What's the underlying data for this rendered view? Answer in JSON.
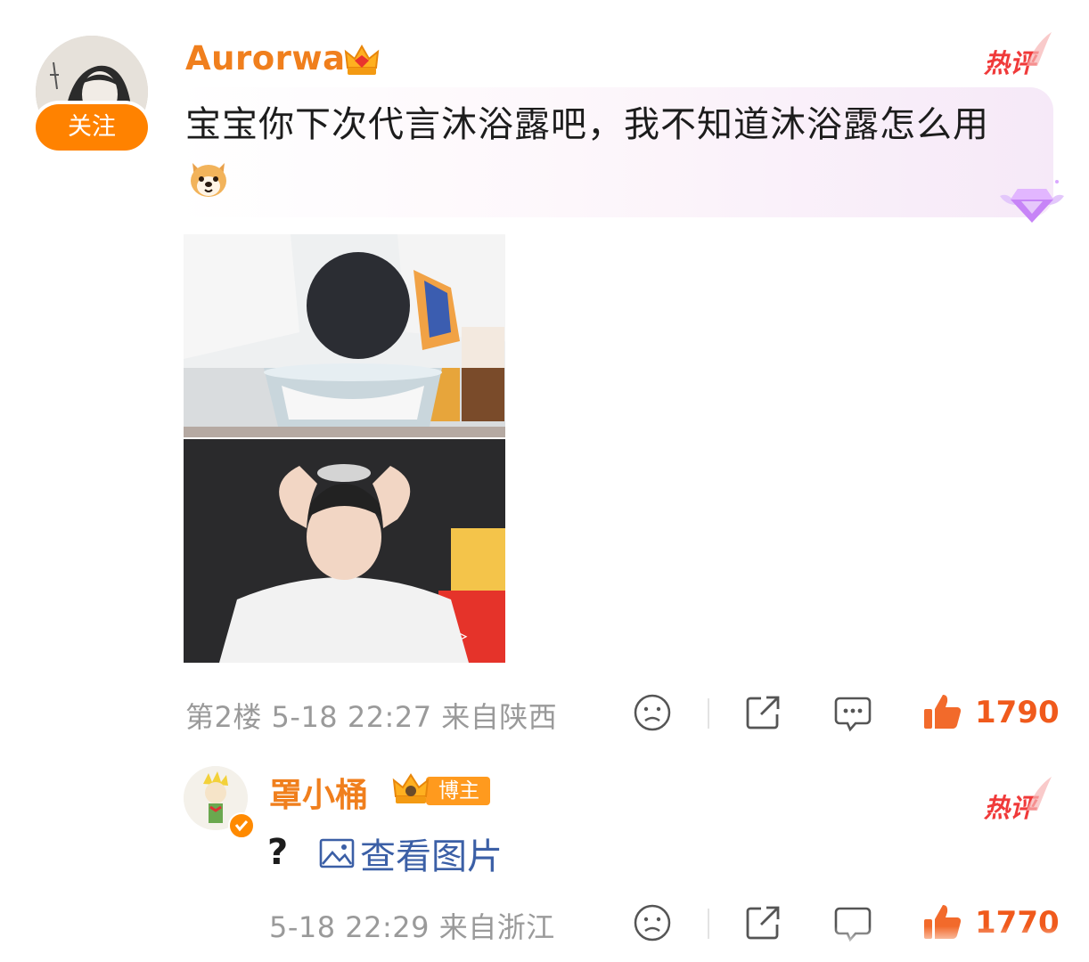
{
  "comments": [
    {
      "username": "Aurorwa",
      "follow_label": "关注",
      "hot_tag": "热评",
      "text": "宝宝你下次代言沐浴露吧，我不知道沐浴露怎么用",
      "floor_meta": "第2楼 5-18 22:27 来自陕西",
      "likes": "1790",
      "icons": [
        "crown-icon",
        "dog-emoji-icon",
        "gem-badge-icon",
        "sad-face-icon",
        "share-icon",
        "comment-icon",
        "thumbs-up-icon"
      ]
    },
    {
      "username": "罩小桶",
      "blogger_tag": "博主",
      "hot_tag": "热评",
      "text": "?",
      "view_image_label": "查看图片",
      "meta": "5-18 22:29 来自浙江",
      "likes": "1770",
      "icons": [
        "crown-icon",
        "verified-badge-icon",
        "image-icon",
        "sad-face-icon",
        "share-icon",
        "comment-icon",
        "thumbs-up-icon"
      ]
    }
  ],
  "colors": {
    "username": "#f07f1d",
    "follow_button": "#ff8200",
    "hot_tag": "#f03a3a",
    "like_count": "#f05a1c",
    "link": "#3b5fa6",
    "meta": "#9a9a9a"
  }
}
